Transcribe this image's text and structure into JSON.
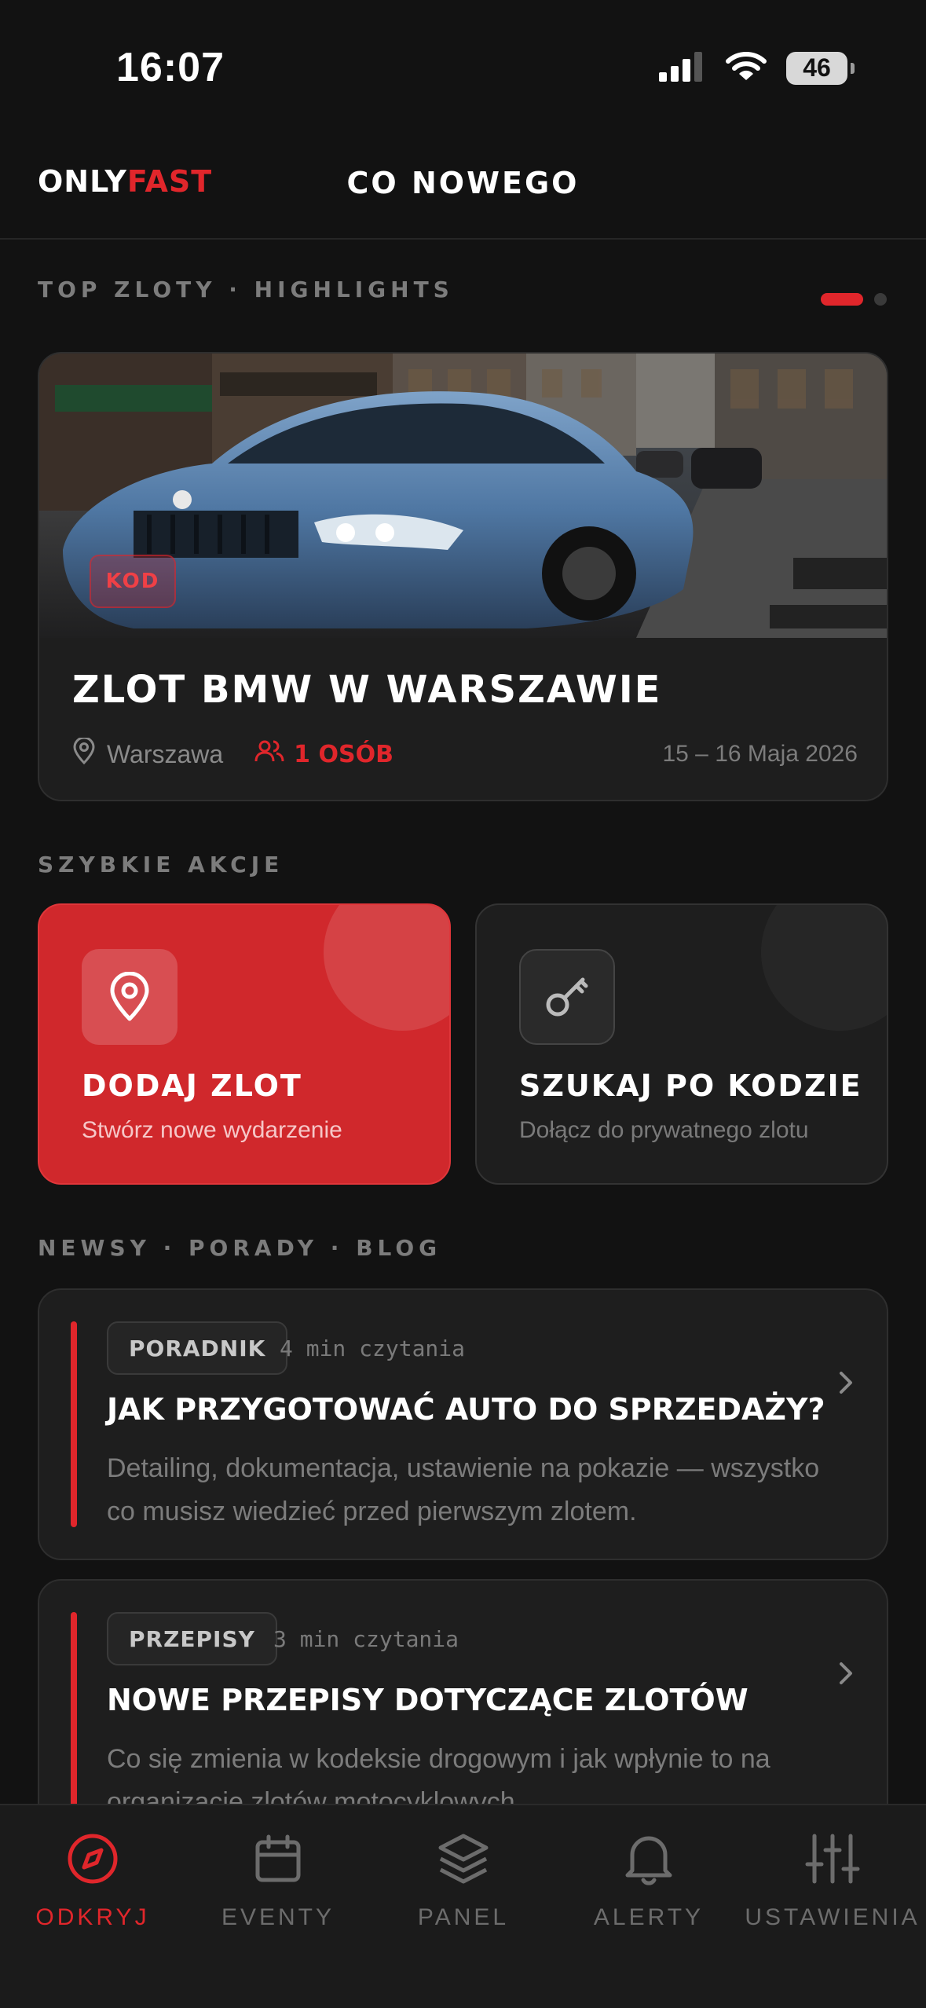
{
  "status_bar": {
    "time": "16:07",
    "battery": "46"
  },
  "header": {
    "logo_part1": "ONLY",
    "logo_part2": "FAST",
    "title": "CO NOWEGO"
  },
  "highlights": {
    "section_label": "TOP ZLOTY · HIGHLIGHTS",
    "badge": "KOD",
    "title": "ZLOT BMW W WARSZAWIE",
    "location": "Warszawa",
    "people": "1 OSÓB",
    "date": "15 – 16 Maja 2026"
  },
  "quick_actions": {
    "section_label": "SZYBKIE AKCJE",
    "items": [
      {
        "title": "DODAJ ZLOT",
        "subtitle": "Stwórz nowe wydarzenie",
        "icon": "map-pin-icon"
      },
      {
        "title": "SZUKAJ PO KODZIE",
        "subtitle": "Dołącz do prywatnego zlotu",
        "icon": "key-icon"
      }
    ]
  },
  "news": {
    "section_label": "NEWSY · PORADY · BLOG",
    "items": [
      {
        "tag": "PORADNIK",
        "read_time": "4 min czytania",
        "title": "JAK PRZYGOTOWAĆ AUTO DO SPRZEDAŻY?",
        "excerpt": "Detailing, dokumentacja, ustawienie na pokazie — wszystko co musisz wiedzieć przed pierwszym zlotem."
      },
      {
        "tag": "PRZEPISY",
        "read_time": "3 min czytania",
        "title": "NOWE PRZEPISY DOTYCZĄCE ZLOTÓW",
        "excerpt": "Co się zmienia w kodeksie drogowym i jak wpłynie to na organizację zlotów motocyklowych."
      }
    ]
  },
  "tabbar": {
    "items": [
      {
        "label": "ODKRYJ",
        "icon": "compass-icon",
        "active": true
      },
      {
        "label": "EVENTY",
        "icon": "calendar-icon",
        "active": false
      },
      {
        "label": "PANEL",
        "icon": "layers-icon",
        "active": false
      },
      {
        "label": "ALERTY",
        "icon": "bell-icon",
        "active": false
      },
      {
        "label": "USTAWIENIA",
        "icon": "sliders-icon",
        "active": false
      }
    ]
  },
  "colors": {
    "accent": "#e0262b",
    "background": "#121212",
    "card": "#1e1e1e"
  }
}
